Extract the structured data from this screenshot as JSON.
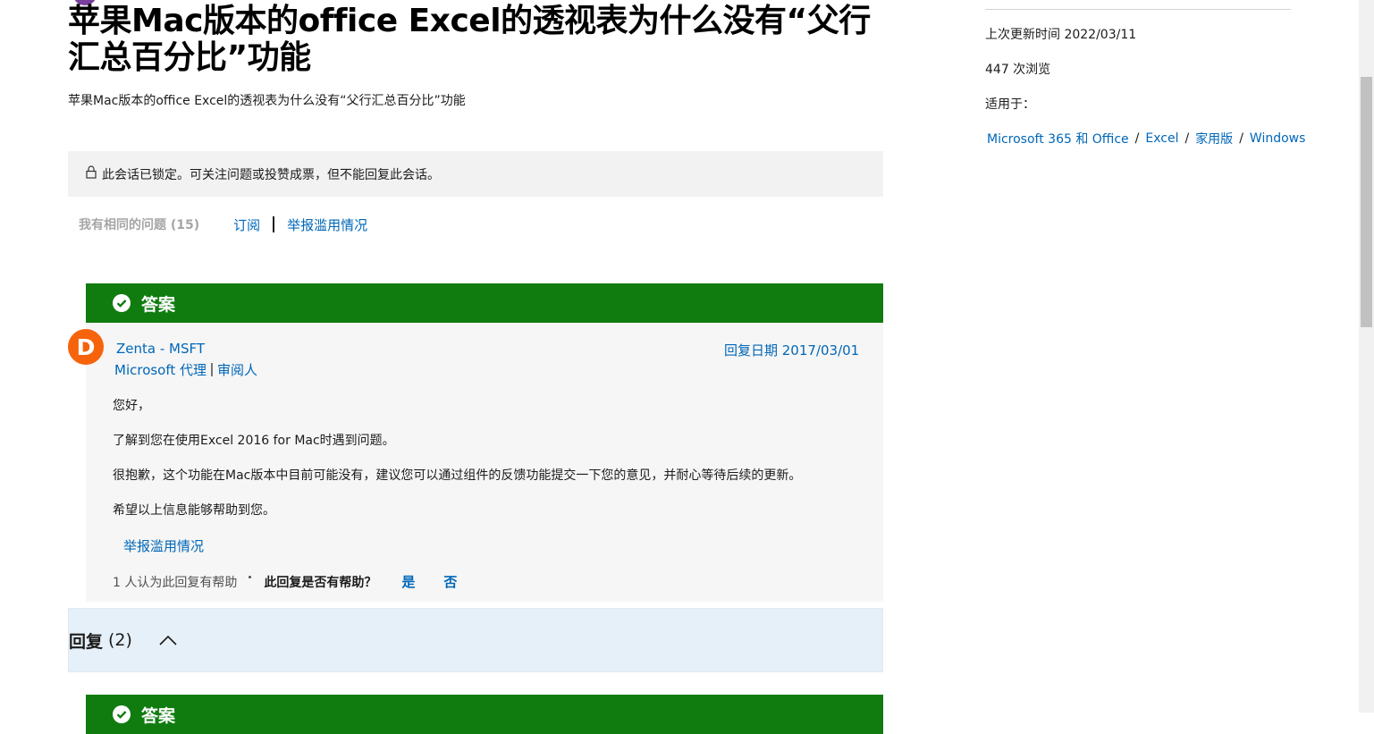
{
  "question": {
    "title": "苹果Mac版本的office Excel的透视表为什么没有“父行汇总百分比”功能",
    "body": "苹果Mac版本的office Excel的透视表为什么没有“父行汇总百分比”功能",
    "locked_notice": "此会话已锁定。可关注问题或投赞成票，但不能回复此会话。",
    "same_question": "我有相同的问题 (15)",
    "subscribe": "订阅",
    "report_abuse": "举报滥用情况"
  },
  "answer": {
    "banner": "答案",
    "avatar_letter": "D",
    "author": "Zenta - MSFT",
    "role1": "Microsoft 代理",
    "role2": "审阅人",
    "reply_date": "回复日期 2017/03/01",
    "paragraphs": [
      "您好，",
      "了解到您在使用Excel 2016 for Mac时遇到问题。",
      "很抱歉，这个功能在Mac版本中目前可能没有，建议您可以通过组件的反馈功能提交一下您的意见，并耐心等待后续的更新。",
      "希望以上信息能够帮助到您。"
    ],
    "report_abuse": "举报滥用情况",
    "helpful_count": "1 人认为此回复有帮助",
    "helpful_question": "此回复是否有帮助？",
    "yes": "是",
    "no": "否"
  },
  "replies": {
    "label": "回复",
    "count": "(2)"
  },
  "answer2": {
    "banner": "答案"
  },
  "sidebar": {
    "last_updated": "上次更新时间 2022/03/11",
    "views": "447 次浏览",
    "applies_to": "适用于：",
    "tags": [
      "Microsoft 365 和 Office",
      "Excel",
      "家用版",
      "Windows"
    ]
  },
  "colors": {
    "accent": "#0067b8",
    "answer_green": "#107c10",
    "avatar_orange": "#f7630c"
  }
}
